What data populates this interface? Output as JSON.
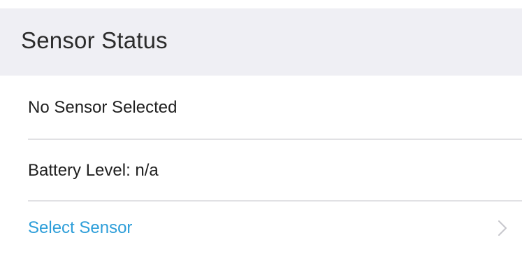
{
  "section": {
    "title": "Sensor Status"
  },
  "rows": [
    {
      "label": "No Sensor Selected"
    },
    {
      "label": "Battery Level: n/a"
    },
    {
      "label": "Select Sensor"
    }
  ],
  "colors": {
    "header_bg": "#efeff4",
    "link": "#2d9ed9",
    "separator": "#e1e1e4",
    "chevron": "#c7c7cc"
  },
  "icons": {
    "disclosure": "chevron-right-icon"
  }
}
